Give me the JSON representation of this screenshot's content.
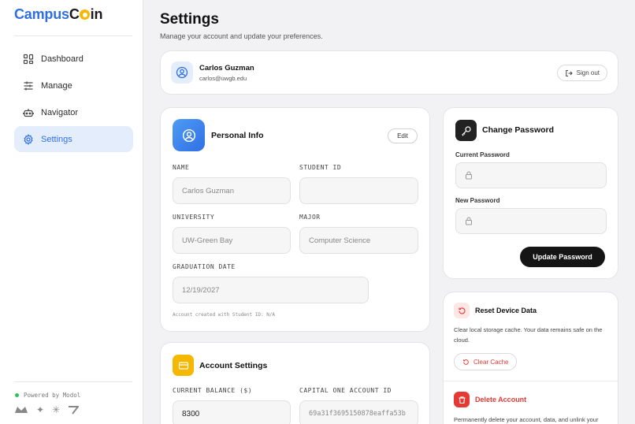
{
  "brand": {
    "part1": "Campus",
    "part2_prefix": "C",
    "part2_suffix": "in"
  },
  "sidebar": {
    "items": [
      {
        "label": "Dashboard",
        "icon": "grid-icon"
      },
      {
        "label": "Manage",
        "icon": "sliders-icon"
      },
      {
        "label": "Navigator",
        "icon": "robot-icon"
      },
      {
        "label": "Settings",
        "icon": "gear-icon",
        "active": true
      }
    ],
    "powered_by": "Powered by Modol"
  },
  "page": {
    "title": "Settings",
    "subtitle": "Manage your account and update your preferences."
  },
  "profile": {
    "name": "Carlos Guzman",
    "email": "carlos@uwgb.edu",
    "signout_label": "Sign out"
  },
  "personal_info": {
    "title": "Personal Info",
    "edit_label": "Edit",
    "name_label": "NAME",
    "name_value": "Carlos Guzman",
    "student_id_label": "STUDENT ID",
    "student_id_value": "",
    "university_label": "UNIVERSITY",
    "university_value": "UW-Green Bay",
    "major_label": "MAJOR",
    "major_value": "Computer Science",
    "grad_label": "GRADUATION DATE",
    "grad_value": "12/19/2027",
    "footnote": "Account created with Student ID: N/A"
  },
  "account_settings": {
    "title": "Account Settings",
    "balance_label": "CURRENT BALANCE ($)",
    "balance_value": "8300",
    "capital_label": "CAPITAL ONE ACCOUNT ID",
    "capital_value": "69a31f3695150878eaffa53b"
  },
  "change_password": {
    "title": "Change Password",
    "current_label": "Current Password",
    "new_label": "New Password",
    "update_label": "Update Password"
  },
  "reset_device": {
    "title": "Reset Device Data",
    "description": "Clear local storage cache. Your data remains safe on the cloud.",
    "button_label": "Clear Cache"
  },
  "delete_account": {
    "title": "Delete Account",
    "description": "Permanently delete your account, data, and unlink your"
  },
  "colors": {
    "accent": "#2f6fe4",
    "danger": "#e53935",
    "coin": "#f5b700"
  }
}
